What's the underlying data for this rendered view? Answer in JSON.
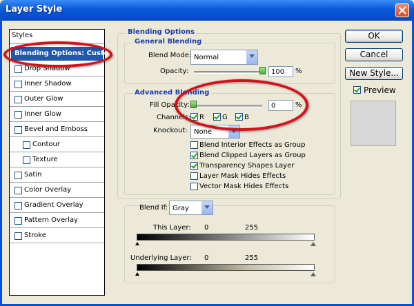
{
  "window": {
    "title": "Layer Style"
  },
  "styles_panel": {
    "header": "Styles",
    "selected": "Blending Options: Custom",
    "items": [
      {
        "label": "Drop Shadow",
        "checked": false
      },
      {
        "label": "Inner Shadow",
        "checked": false
      },
      {
        "label": "Outer Glow",
        "checked": false
      },
      {
        "label": "Inner Glow",
        "checked": false
      },
      {
        "label": "Bevel and Emboss",
        "checked": false
      },
      {
        "label": "Contour",
        "checked": false
      },
      {
        "label": "Texture",
        "checked": false
      },
      {
        "label": "Satin",
        "checked": false
      },
      {
        "label": "Color Overlay",
        "checked": false
      },
      {
        "label": "Gradient Overlay",
        "checked": false
      },
      {
        "label": "Pattern Overlay",
        "checked": false
      },
      {
        "label": "Stroke",
        "checked": false
      }
    ]
  },
  "blending": {
    "section_title": "Blending Options",
    "general_title": "General Blending",
    "blend_mode_label": "Blend Mode:",
    "blend_mode_value": "Normal",
    "opacity_label": "Opacity:",
    "opacity_value": "100",
    "opacity_unit": "%",
    "opacity_level": 1.0
  },
  "advanced": {
    "title": "Advanced Blending",
    "fill_opacity_label": "Fill Opacity:",
    "fill_opacity_value": "0",
    "fill_opacity_unit": "%",
    "fill_opacity_level": 0.0,
    "channels_label": "Channels:",
    "channels": [
      {
        "label": "R",
        "checked": true
      },
      {
        "label": "G",
        "checked": true
      },
      {
        "label": "B",
        "checked": true
      }
    ],
    "knockout_label": "Knockout:",
    "knockout_value": "None",
    "options": [
      {
        "label": "Blend Interior Effects as Group",
        "checked": false
      },
      {
        "label": "Blend Clipped Layers as Group",
        "checked": true
      },
      {
        "label": "Transparency Shapes Layer",
        "checked": true
      },
      {
        "label": "Layer Mask Hides Effects",
        "checked": false
      },
      {
        "label": "Vector Mask Hides Effects",
        "checked": false
      }
    ]
  },
  "blend_if": {
    "label": "Blend If:",
    "value": "Gray",
    "this_layer_label": "This Layer:",
    "this_layer_min": "0",
    "this_layer_max": "255",
    "underlying_label": "Underlying Layer:",
    "underlying_min": "0",
    "underlying_max": "255"
  },
  "buttons": {
    "ok": "OK",
    "cancel": "Cancel",
    "new_style": "New Style...",
    "preview_label": "Preview",
    "preview_checked": true
  },
  "colors": {
    "title_bar": "#0b58d8",
    "highlight": "#d6101a",
    "selected_row": "#2258a9",
    "group_title": "#1c3dab"
  }
}
